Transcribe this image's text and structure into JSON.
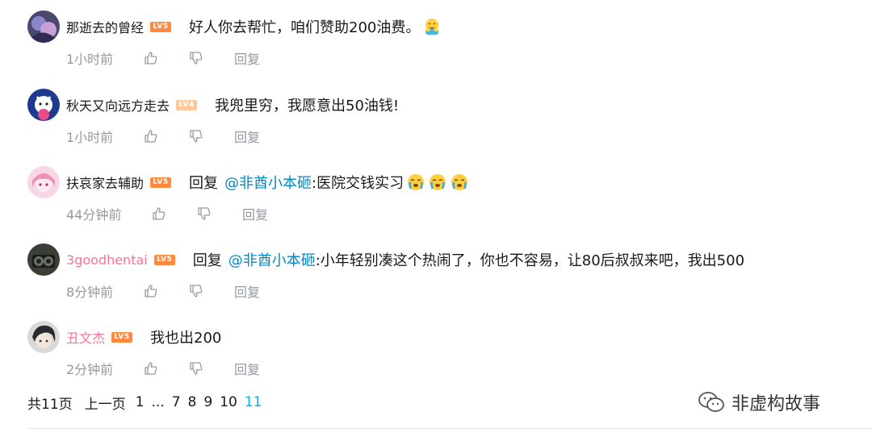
{
  "comments": [
    {
      "username": "那逝去的曾经",
      "level": "LV5",
      "text": "好人你去帮忙，咱们赞助200油费。",
      "emoji": [
        "hug-emoji"
      ],
      "time": "1小时前",
      "reply_label": "回复"
    },
    {
      "username": "秋天又向远方走去",
      "level": "LV4",
      "text": "我兜里穷，我愿意出50油钱!",
      "time": "1小时前",
      "reply_label": "回复"
    },
    {
      "username": "扶哀家去辅助",
      "level": "LV5",
      "reply_prefix": "回复",
      "mention": "@非酋小本砸",
      "text": ":医院交钱实习",
      "emoji": [
        "crying-emoji",
        "crying-emoji",
        "crying-emoji"
      ],
      "time": "44分钟前",
      "reply_label": "回复"
    },
    {
      "username": "3goodhentai",
      "level": "LV5",
      "reply_prefix": "回复",
      "mention": "@非酋小本砸",
      "text": ":小年轻别凑这个热闹了，你也不容易，让80后叔叔来吧，我出500",
      "time": "8分钟前",
      "reply_label": "回复"
    },
    {
      "username": "丑文杰",
      "level": "LV5",
      "text": "我也出200",
      "time": "2分钟前",
      "reply_label": "回复"
    }
  ],
  "pagination": {
    "total": "共11页",
    "prev": "上一页",
    "pages": [
      "1",
      "...",
      "7",
      "8",
      "9",
      "10"
    ],
    "current": "11"
  },
  "watermark": {
    "text": "非虚构故事"
  },
  "colors": {
    "level5": "#ff8a3d",
    "level4": "#ffc89a",
    "mention": "#008ac5",
    "pink_username": "#fb7299",
    "meta": "#9499a0",
    "current_page": "#00aeec"
  }
}
